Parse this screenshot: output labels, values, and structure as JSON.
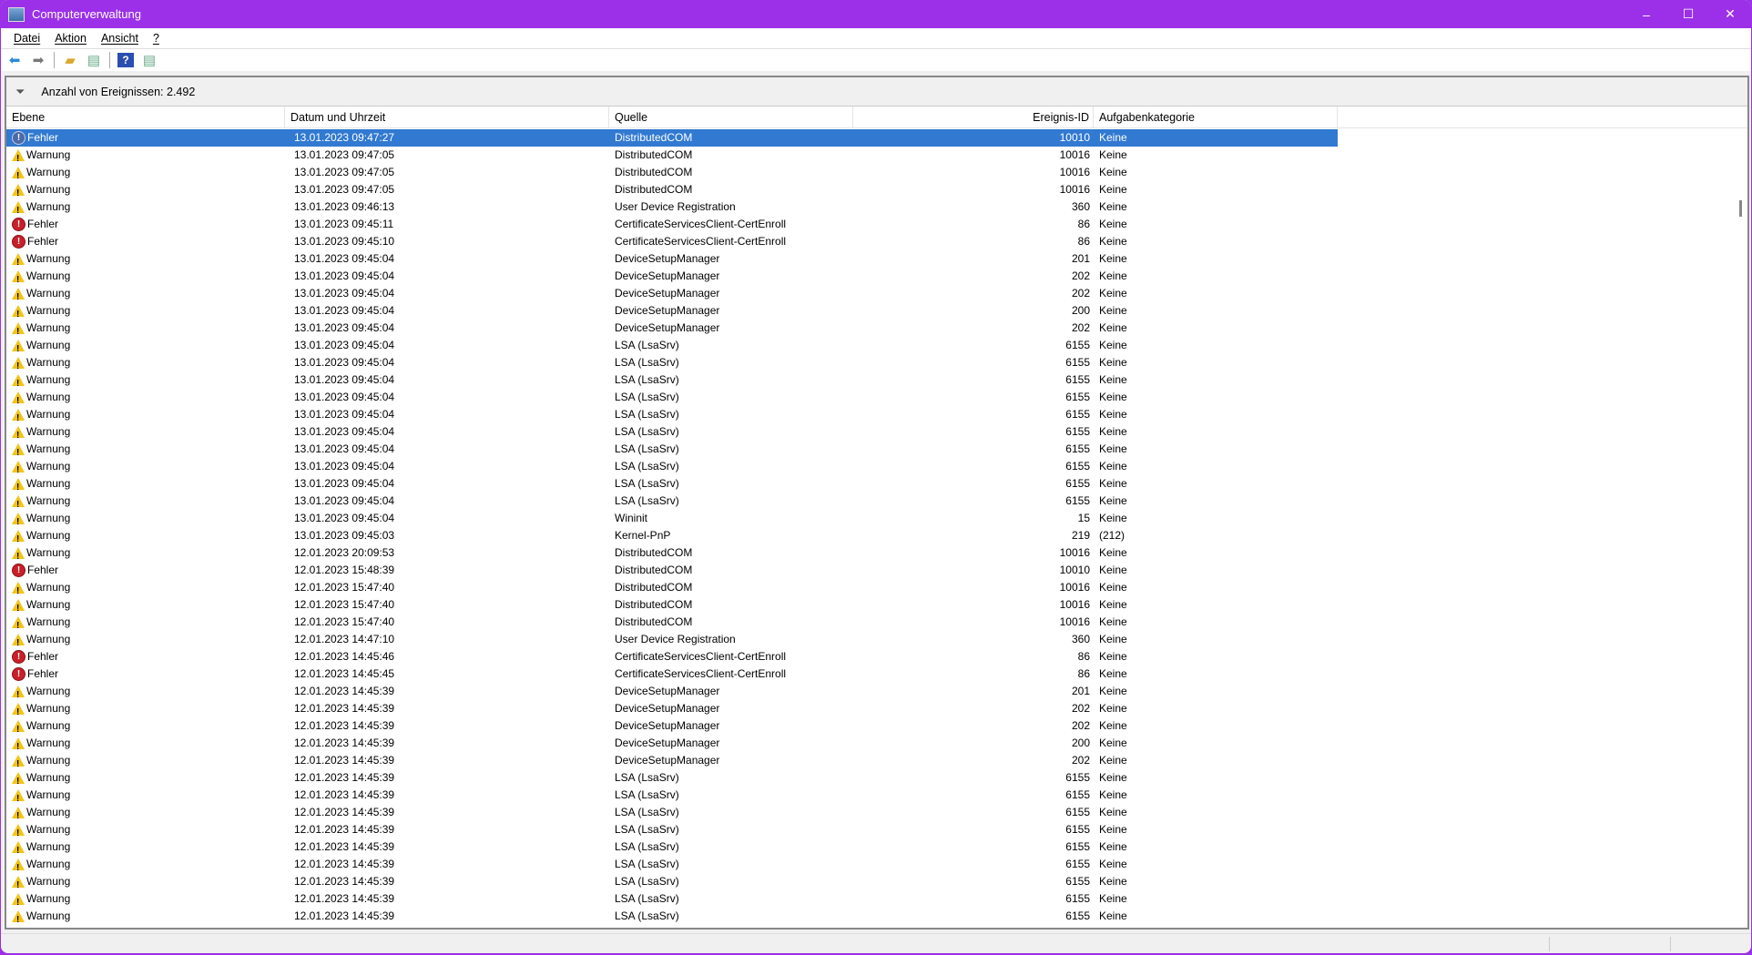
{
  "window": {
    "title": "Computerverwaltung",
    "minimize": "–",
    "maximize": "☐",
    "close": "✕"
  },
  "menu": [
    "Datei",
    "Aktion",
    "Ansicht",
    "?"
  ],
  "filter": {
    "text": "Anzahl von Ereignissen: 2.492"
  },
  "columns": [
    "Ebene",
    "Datum und Uhrzeit",
    "Quelle",
    "Ereignis-ID",
    "Aufgabenkategorie"
  ],
  "rows": [
    [
      "Fehler",
      "13.01.2023 09:47:27",
      "DistributedCOM",
      "10010",
      "Keine"
    ],
    [
      "Warnung",
      "13.01.2023 09:47:05",
      "DistributedCOM",
      "10016",
      "Keine"
    ],
    [
      "Warnung",
      "13.01.2023 09:47:05",
      "DistributedCOM",
      "10016",
      "Keine"
    ],
    [
      "Warnung",
      "13.01.2023 09:47:05",
      "DistributedCOM",
      "10016",
      "Keine"
    ],
    [
      "Warnung",
      "13.01.2023 09:46:13",
      "User Device Registration",
      "360",
      "Keine"
    ],
    [
      "Fehler",
      "13.01.2023 09:45:11",
      "CertificateServicesClient-CertEnroll",
      "86",
      "Keine"
    ],
    [
      "Fehler",
      "13.01.2023 09:45:10",
      "CertificateServicesClient-CertEnroll",
      "86",
      "Keine"
    ],
    [
      "Warnung",
      "13.01.2023 09:45:04",
      "DeviceSetupManager",
      "201",
      "Keine"
    ],
    [
      "Warnung",
      "13.01.2023 09:45:04",
      "DeviceSetupManager",
      "202",
      "Keine"
    ],
    [
      "Warnung",
      "13.01.2023 09:45:04",
      "DeviceSetupManager",
      "202",
      "Keine"
    ],
    [
      "Warnung",
      "13.01.2023 09:45:04",
      "DeviceSetupManager",
      "200",
      "Keine"
    ],
    [
      "Warnung",
      "13.01.2023 09:45:04",
      "DeviceSetupManager",
      "202",
      "Keine"
    ],
    [
      "Warnung",
      "13.01.2023 09:45:04",
      "LSA (LsaSrv)",
      "6155",
      "Keine"
    ],
    [
      "Warnung",
      "13.01.2023 09:45:04",
      "LSA (LsaSrv)",
      "6155",
      "Keine"
    ],
    [
      "Warnung",
      "13.01.2023 09:45:04",
      "LSA (LsaSrv)",
      "6155",
      "Keine"
    ],
    [
      "Warnung",
      "13.01.2023 09:45:04",
      "LSA (LsaSrv)",
      "6155",
      "Keine"
    ],
    [
      "Warnung",
      "13.01.2023 09:45:04",
      "LSA (LsaSrv)",
      "6155",
      "Keine"
    ],
    [
      "Warnung",
      "13.01.2023 09:45:04",
      "LSA (LsaSrv)",
      "6155",
      "Keine"
    ],
    [
      "Warnung",
      "13.01.2023 09:45:04",
      "LSA (LsaSrv)",
      "6155",
      "Keine"
    ],
    [
      "Warnung",
      "13.01.2023 09:45:04",
      "LSA (LsaSrv)",
      "6155",
      "Keine"
    ],
    [
      "Warnung",
      "13.01.2023 09:45:04",
      "LSA (LsaSrv)",
      "6155",
      "Keine"
    ],
    [
      "Warnung",
      "13.01.2023 09:45:04",
      "LSA (LsaSrv)",
      "6155",
      "Keine"
    ],
    [
      "Warnung",
      "13.01.2023 09:45:04",
      "Wininit",
      "15",
      "Keine"
    ],
    [
      "Warnung",
      "13.01.2023 09:45:03",
      "Kernel-PnP",
      "219",
      "(212)"
    ],
    [
      "Warnung",
      "12.01.2023 20:09:53",
      "DistributedCOM",
      "10016",
      "Keine"
    ],
    [
      "Fehler",
      "12.01.2023 15:48:39",
      "DistributedCOM",
      "10010",
      "Keine"
    ],
    [
      "Warnung",
      "12.01.2023 15:47:40",
      "DistributedCOM",
      "10016",
      "Keine"
    ],
    [
      "Warnung",
      "12.01.2023 15:47:40",
      "DistributedCOM",
      "10016",
      "Keine"
    ],
    [
      "Warnung",
      "12.01.2023 15:47:40",
      "DistributedCOM",
      "10016",
      "Keine"
    ],
    [
      "Warnung",
      "12.01.2023 14:47:10",
      "User Device Registration",
      "360",
      "Keine"
    ],
    [
      "Fehler",
      "12.01.2023 14:45:46",
      "CertificateServicesClient-CertEnroll",
      "86",
      "Keine"
    ],
    [
      "Fehler",
      "12.01.2023 14:45:45",
      "CertificateServicesClient-CertEnroll",
      "86",
      "Keine"
    ],
    [
      "Warnung",
      "12.01.2023 14:45:39",
      "DeviceSetupManager",
      "201",
      "Keine"
    ],
    [
      "Warnung",
      "12.01.2023 14:45:39",
      "DeviceSetupManager",
      "202",
      "Keine"
    ],
    [
      "Warnung",
      "12.01.2023 14:45:39",
      "DeviceSetupManager",
      "202",
      "Keine"
    ],
    [
      "Warnung",
      "12.01.2023 14:45:39",
      "DeviceSetupManager",
      "200",
      "Keine"
    ],
    [
      "Warnung",
      "12.01.2023 14:45:39",
      "DeviceSetupManager",
      "202",
      "Keine"
    ],
    [
      "Warnung",
      "12.01.2023 14:45:39",
      "LSA (LsaSrv)",
      "6155",
      "Keine"
    ],
    [
      "Warnung",
      "12.01.2023 14:45:39",
      "LSA (LsaSrv)",
      "6155",
      "Keine"
    ],
    [
      "Warnung",
      "12.01.2023 14:45:39",
      "LSA (LsaSrv)",
      "6155",
      "Keine"
    ],
    [
      "Warnung",
      "12.01.2023 14:45:39",
      "LSA (LsaSrv)",
      "6155",
      "Keine"
    ],
    [
      "Warnung",
      "12.01.2023 14:45:39",
      "LSA (LsaSrv)",
      "6155",
      "Keine"
    ],
    [
      "Warnung",
      "12.01.2023 14:45:39",
      "LSA (LsaSrv)",
      "6155",
      "Keine"
    ],
    [
      "Warnung",
      "12.01.2023 14:45:39",
      "LSA (LsaSrv)",
      "6155",
      "Keine"
    ],
    [
      "Warnung",
      "12.01.2023 14:45:39",
      "LSA (LsaSrv)",
      "6155",
      "Keine"
    ],
    [
      "Warnung",
      "12.01.2023 14:45:39",
      "LSA (LsaSrv)",
      "6155",
      "Keine"
    ]
  ]
}
